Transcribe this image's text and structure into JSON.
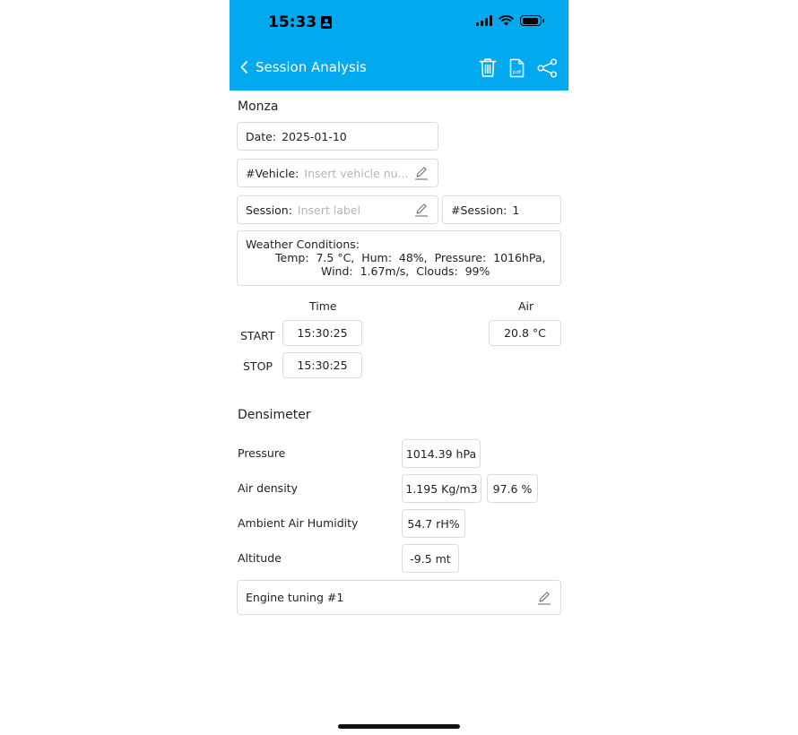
{
  "status_bar": {
    "time": "15:33"
  },
  "header": {
    "back_icon": "chevron-left-icon",
    "title": "Session Analysis",
    "actions": [
      "trash-icon",
      "pdf-file-icon",
      "share-icon"
    ],
    "pdf_badge": "pdf",
    "bg_color": "#03a9ee"
  },
  "session": {
    "track": "Monza",
    "date_label": "Date:",
    "date_value": "2025-01-10",
    "vehicle_label": "#Vehicle:",
    "vehicle_placeholder": "Insert vehicle nu...",
    "session_label": "Session:",
    "session_placeholder": "Insert label",
    "session_num_label": "#Session:",
    "session_num_value": "1"
  },
  "weather": {
    "title": "Weather Conditions:",
    "line1": "Temp:  7.5 °C,  Hum:  48%,  Pressure:  1016hPa,",
    "line2": "Wind:  1.67m/s,  Clouds:  99%"
  },
  "timing": {
    "time_header": "Time",
    "air_header": "Air",
    "start_label": "START",
    "start_value": "15:30:25",
    "stop_label": "STOP",
    "stop_value": "15:30:25",
    "air_value": "20.8 °C"
  },
  "densimeter": {
    "title": "Densimeter",
    "pressure_label": "Pressure",
    "pressure_value": "1014.39 hPa",
    "density_label": "Air density",
    "density_value": "1.195 Kg/m3",
    "density_percent": "97.6 %",
    "humidity_label": "Ambient Air Humidity",
    "humidity_value": "54.7 rH%",
    "altitude_label": "Altitude",
    "altitude_value": "-9.5 mt",
    "tuning_value": "Engine tuning #1"
  }
}
